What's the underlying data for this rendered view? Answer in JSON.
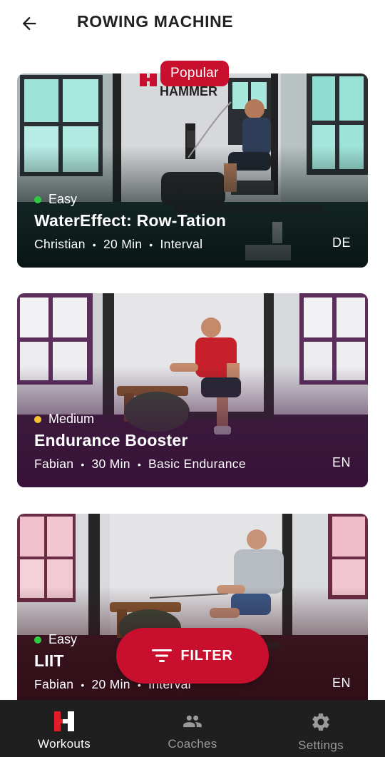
{
  "header": {
    "title": "ROWING MACHINE"
  },
  "cards": [
    {
      "badge": "Popular",
      "level": "Easy",
      "level_color": "#2ecc40",
      "title": "WaterEffect: Row-Tation",
      "coach": "Christian",
      "duration": "20 Min",
      "category": "Interval",
      "language": "DE",
      "brand_sign": "HAMMER"
    },
    {
      "level": "Medium",
      "level_color": "#f4c430",
      "title": "Endurance Booster",
      "coach": "Fabian",
      "duration": "30 Min",
      "category": "Basic Endurance",
      "language": "EN"
    },
    {
      "level": "Easy",
      "level_color": "#2ecc40",
      "title": "LIIT",
      "coach": "Fabian",
      "duration": "20 Min",
      "category": "Interval",
      "language": "EN"
    }
  ],
  "meta_separator": "•",
  "filter": {
    "label": "FILTER"
  },
  "nav": {
    "items": [
      {
        "label": "Workouts",
        "icon": "hammer-logo-icon",
        "active": true
      },
      {
        "label": "Coaches",
        "icon": "people-icon",
        "active": false
      },
      {
        "label": "Settings",
        "icon": "gear-icon",
        "active": false
      }
    ]
  },
  "colors": {
    "accent": "#c8102e",
    "nav_bg": "#1f1f1f",
    "nav_inactive": "#9a9a9a"
  }
}
